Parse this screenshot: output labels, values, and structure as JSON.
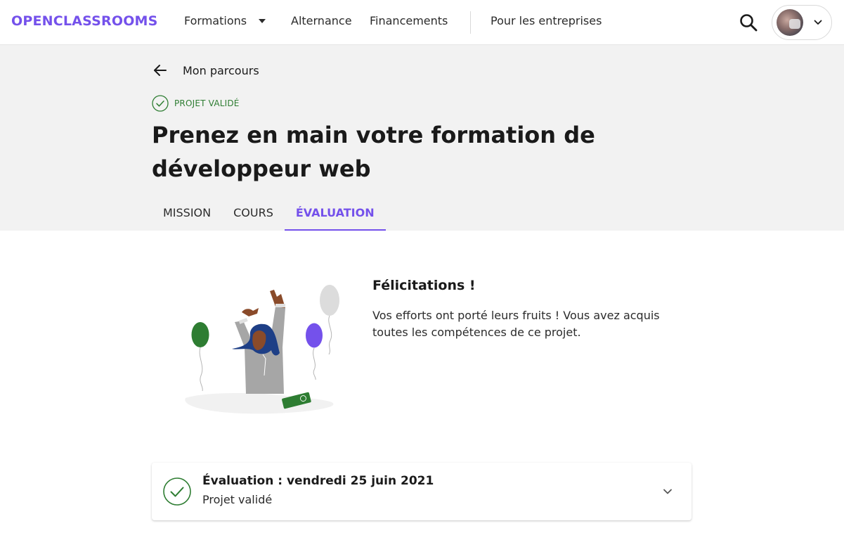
{
  "brand": {
    "logo_text": "OPENCLASSROOMS",
    "accent_color": "#7451eb"
  },
  "nav": {
    "items": [
      {
        "label": "Formations",
        "has_dropdown": true
      },
      {
        "label": "Alternance"
      },
      {
        "label": "Financements"
      },
      {
        "label": "Pour les entreprises"
      }
    ],
    "search_icon": "search-icon",
    "account_chevron_icon": "chevron-down-icon"
  },
  "header": {
    "back_label": "Mon parcours",
    "status_label": "PROJET VALIDÉ",
    "status_color": "#2e7d32",
    "title": "Prenez en main votre formation de développeur web"
  },
  "tabs": [
    {
      "label": "MISSION",
      "active": false
    },
    {
      "label": "COURS",
      "active": false
    },
    {
      "label": "ÉVALUATION",
      "active": true
    }
  ],
  "congrats": {
    "title": "Félicitations !",
    "text": "Vos efforts ont porté leurs fruits ! Vous avez acquis toutes les compétences de ce projet."
  },
  "evaluation": {
    "title": "Évaluation : vendredi 25 juin 2021",
    "subtitle": "Projet validé"
  }
}
